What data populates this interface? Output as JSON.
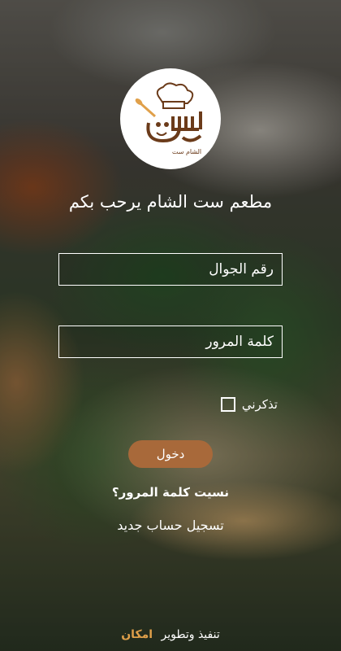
{
  "colors": {
    "accent": "#a8693a",
    "brand_highlight": "#e0a04a",
    "text": "#ffffff"
  },
  "logo": {
    "text": "الشام ست",
    "icon": "chef-hat-logo"
  },
  "welcome": "مطعم ست الشام يرحب بكم",
  "fields": {
    "phone_placeholder": "رقم الجوال",
    "password_placeholder": "كلمة المرور"
  },
  "remember_label": "تذكرني",
  "login_label": "دخول",
  "forgot_label": "نسيت كلمة المرور؟",
  "register_label": "تسجيل حساب جديد",
  "footer": {
    "prefix": "تنفيذ وتطوير",
    "brand": "امكان"
  }
}
